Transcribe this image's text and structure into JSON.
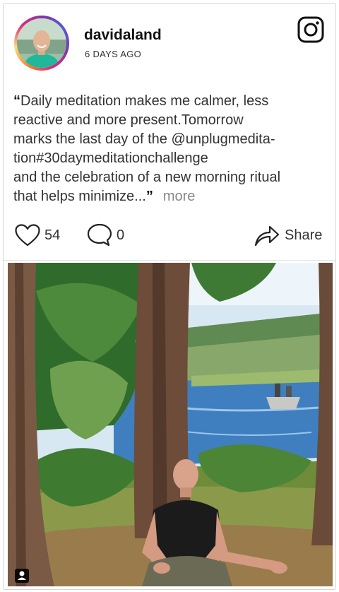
{
  "post": {
    "username": "davidaland",
    "timestamp": "6 DAYS AGO",
    "caption": {
      "open_quote": "“",
      "lines": [
        "Daily meditation makes me calmer, less",
        "reactive and more present.Tomorrow",
        "marks the last day of the @unplugmedita-",
        "tion#30daymeditationchallenge",
        "and the celebration of a new morning ritual",
        "that helps minimize..."
      ],
      "close_quote": "”",
      "more_link": "more"
    },
    "likes": "54",
    "comments": "0",
    "share_label": "Share"
  },
  "icons": {
    "platform": "instagram-icon",
    "like": "heart-icon",
    "comment": "comment-bubble-icon",
    "share": "share-arrow-icon",
    "user_tag": "user-tag-icon"
  },
  "colors": {
    "ring_gradient": [
      "#f58529",
      "#dd2a7b",
      "#8134af",
      "#515bd4"
    ],
    "text_primary": "#111111",
    "text_secondary": "#333333",
    "more_link": "#888888"
  }
}
